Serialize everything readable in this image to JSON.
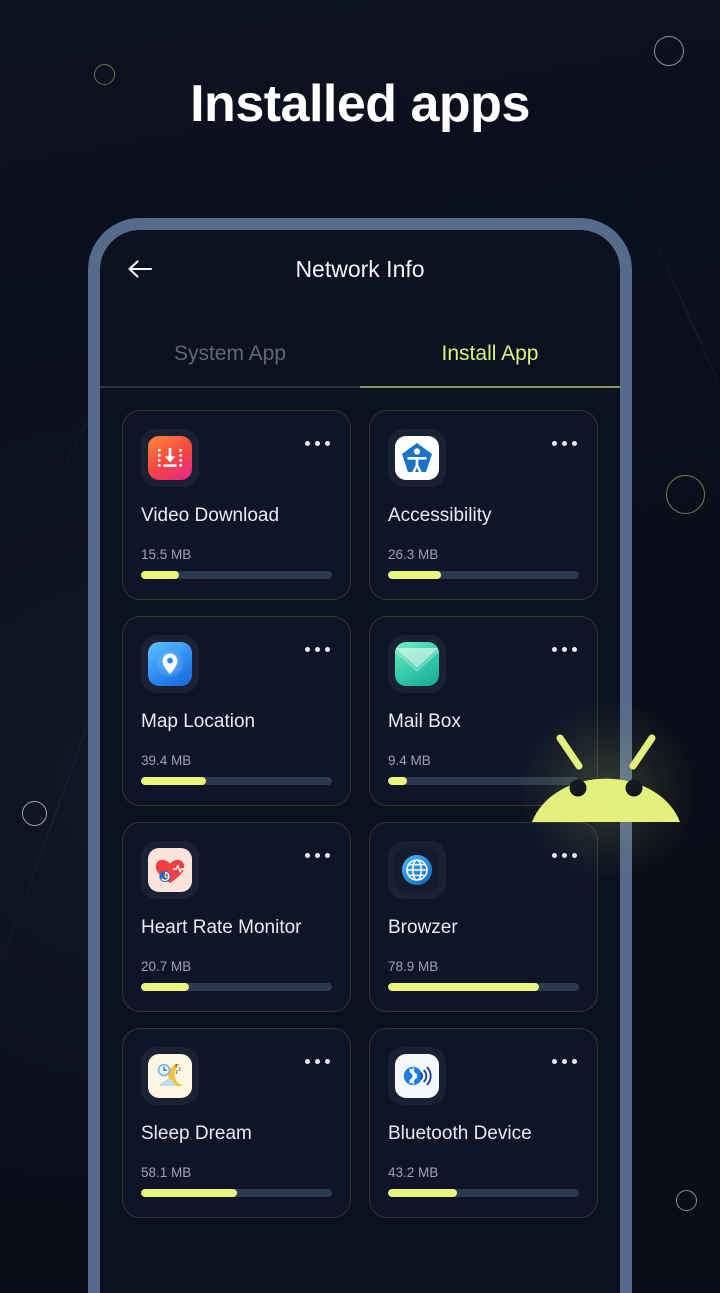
{
  "page": {
    "title": "Installed apps",
    "background_color": "#0a0e1a",
    "accent_color": "#e9f57f"
  },
  "phone": {
    "frame_color": "#566b8c",
    "screen_color": "#0c1120",
    "app_bar": {
      "back_icon": "arrow-left-icon",
      "title": "Network Info"
    },
    "tabs": [
      {
        "label": "System App",
        "active": false
      },
      {
        "label": "Install App",
        "active": true
      }
    ],
    "apps": [
      {
        "name": "Video Download",
        "size": "15.5 MB",
        "progress": 20,
        "icon": "download-icon"
      },
      {
        "name": "Accessibility",
        "size": "26.3 MB",
        "progress": 28,
        "icon": "accessibility-icon"
      },
      {
        "name": "Map Location",
        "size": "39.4 MB",
        "progress": 34,
        "icon": "map-pin-icon"
      },
      {
        "name": "Mail Box",
        "size": "9.4 MB",
        "progress": 10,
        "icon": "envelope-icon"
      },
      {
        "name": "Heart Rate Monitor",
        "size": "20.7 MB",
        "progress": 25,
        "icon": "heart-pulse-icon"
      },
      {
        "name": "Browzer",
        "size": "78.9 MB",
        "progress": 79,
        "icon": "globe-icon"
      },
      {
        "name": "Sleep Dream",
        "size": "58.1 MB",
        "progress": 50,
        "icon": "moon-clock-icon"
      },
      {
        "name": "Bluetooth Device",
        "size": "43.2 MB",
        "progress": 36,
        "icon": "bluetooth-icon"
      }
    ],
    "menu_icon": "ellipsis-icon"
  },
  "decor": {
    "mascot": "android-mascot-icon",
    "mascot_color": "#e4f07e",
    "circles": 5
  }
}
